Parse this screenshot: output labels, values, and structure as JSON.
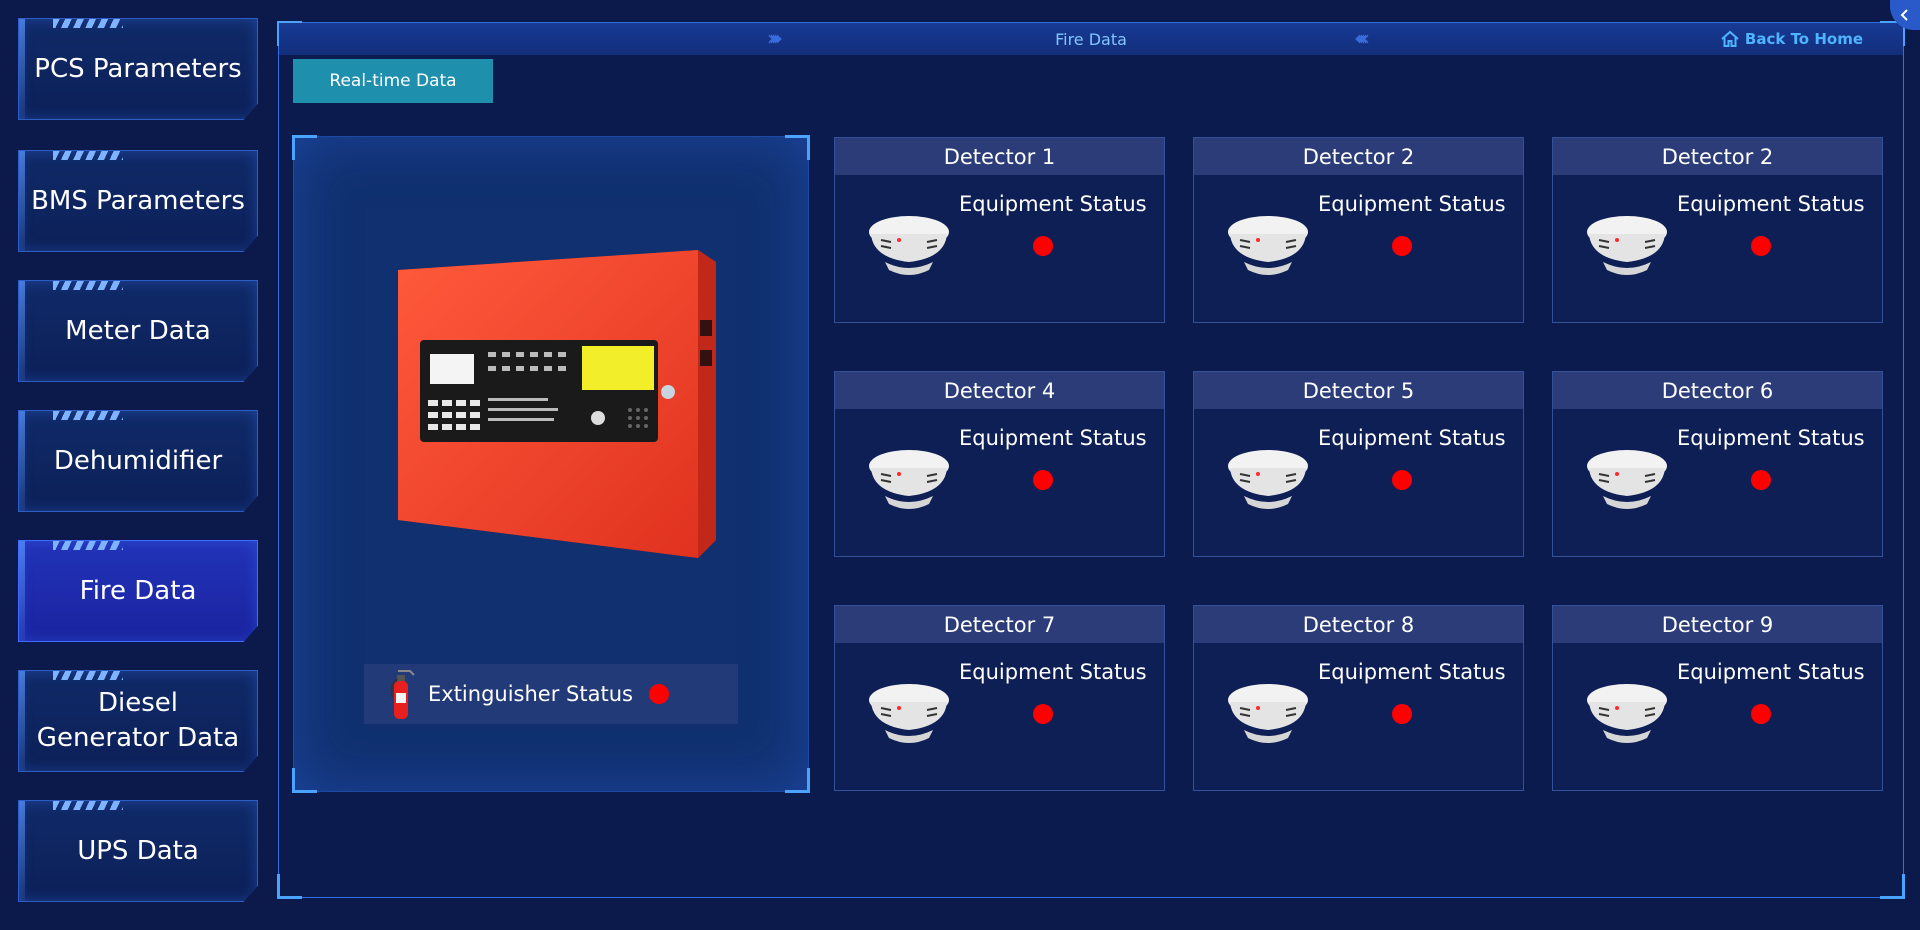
{
  "sidebar": {
    "items": [
      {
        "label": "PCS Parameters",
        "active": false
      },
      {
        "label": "BMS Parameters",
        "active": false
      },
      {
        "label": "Meter Data",
        "active": false
      },
      {
        "label": "Dehumidifier",
        "active": false
      },
      {
        "label": "Fire Data",
        "active": true
      },
      {
        "label": "Diesel Generator Data",
        "active": false
      },
      {
        "label": "UPS Data",
        "active": false
      }
    ]
  },
  "header": {
    "title": "Fire Data",
    "back_home": "Back To Home",
    "chevrons_left": "›››››",
    "chevrons_right": "‹‹‹‹‹"
  },
  "tab": {
    "label": "Real-time Data"
  },
  "extinguisher": {
    "label": "Extinguisher Status",
    "status_color": "#ff0000"
  },
  "detectors": [
    {
      "title": "Detector 1",
      "status_label": "Equipment Status"
    },
    {
      "title": "Detector 2",
      "status_label": "Equipment Status"
    },
    {
      "title": "Detector 2",
      "status_label": "Equipment Status"
    },
    {
      "title": "Detector 4",
      "status_label": "Equipment Status"
    },
    {
      "title": "Detector 5",
      "status_label": "Equipment Status"
    },
    {
      "title": "Detector 6",
      "status_label": "Equipment Status"
    },
    {
      "title": "Detector 7",
      "status_label": "Equipment Status"
    },
    {
      "title": "Detector 8",
      "status_label": "Equipment Status"
    },
    {
      "title": "Detector 9",
      "status_label": "Equipment Status"
    }
  ],
  "colors": {
    "accent": "#1f8fae",
    "status_alarm": "#ff0000",
    "active_nav": "#2233b8"
  }
}
